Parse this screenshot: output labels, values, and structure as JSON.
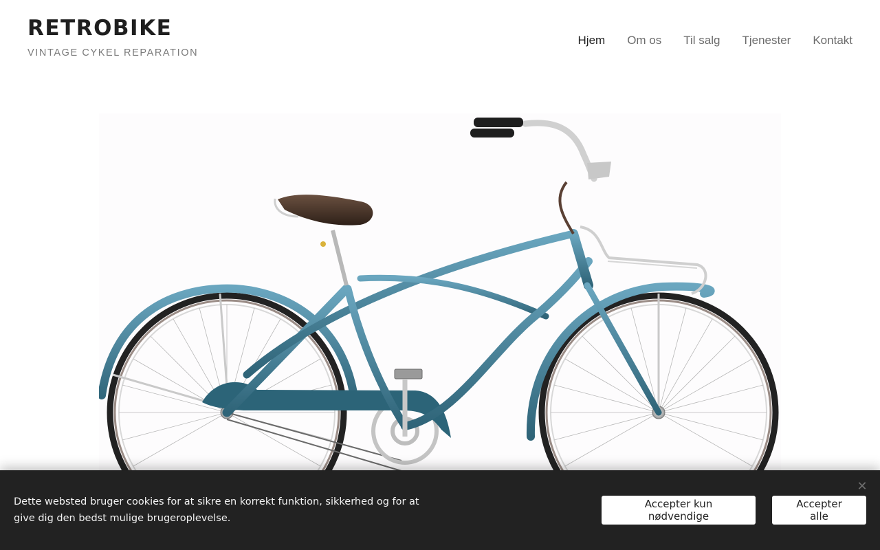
{
  "site": {
    "title": "RETROBIKE",
    "tagline": "VINTAGE CYKEL REPARATION"
  },
  "nav": {
    "items": [
      {
        "label": "Hjem",
        "active": true
      },
      {
        "label": "Om os",
        "active": false
      },
      {
        "label": "Til salg",
        "active": false
      },
      {
        "label": "Tjenester",
        "active": false
      },
      {
        "label": "Kontakt",
        "active": false
      }
    ]
  },
  "hero": {
    "image": "vintage-bicycle-image"
  },
  "cookie": {
    "text": "Dette websted bruger cookies for at sikre en korrekt funktion, sikkerhed og for at give dig den bedst mulige brugeroplevelse.",
    "accept_necessary": "Accepter kun nødvendige",
    "accept_all": "Accepter alle",
    "close_icon": "close-icon"
  },
  "colors": {
    "frame": "#4a8aa6",
    "frame_dark": "#2f6478",
    "cookie_bg": "#222222",
    "text_dark": "#1f1f1f",
    "nav_muted": "#6b6b6b"
  }
}
